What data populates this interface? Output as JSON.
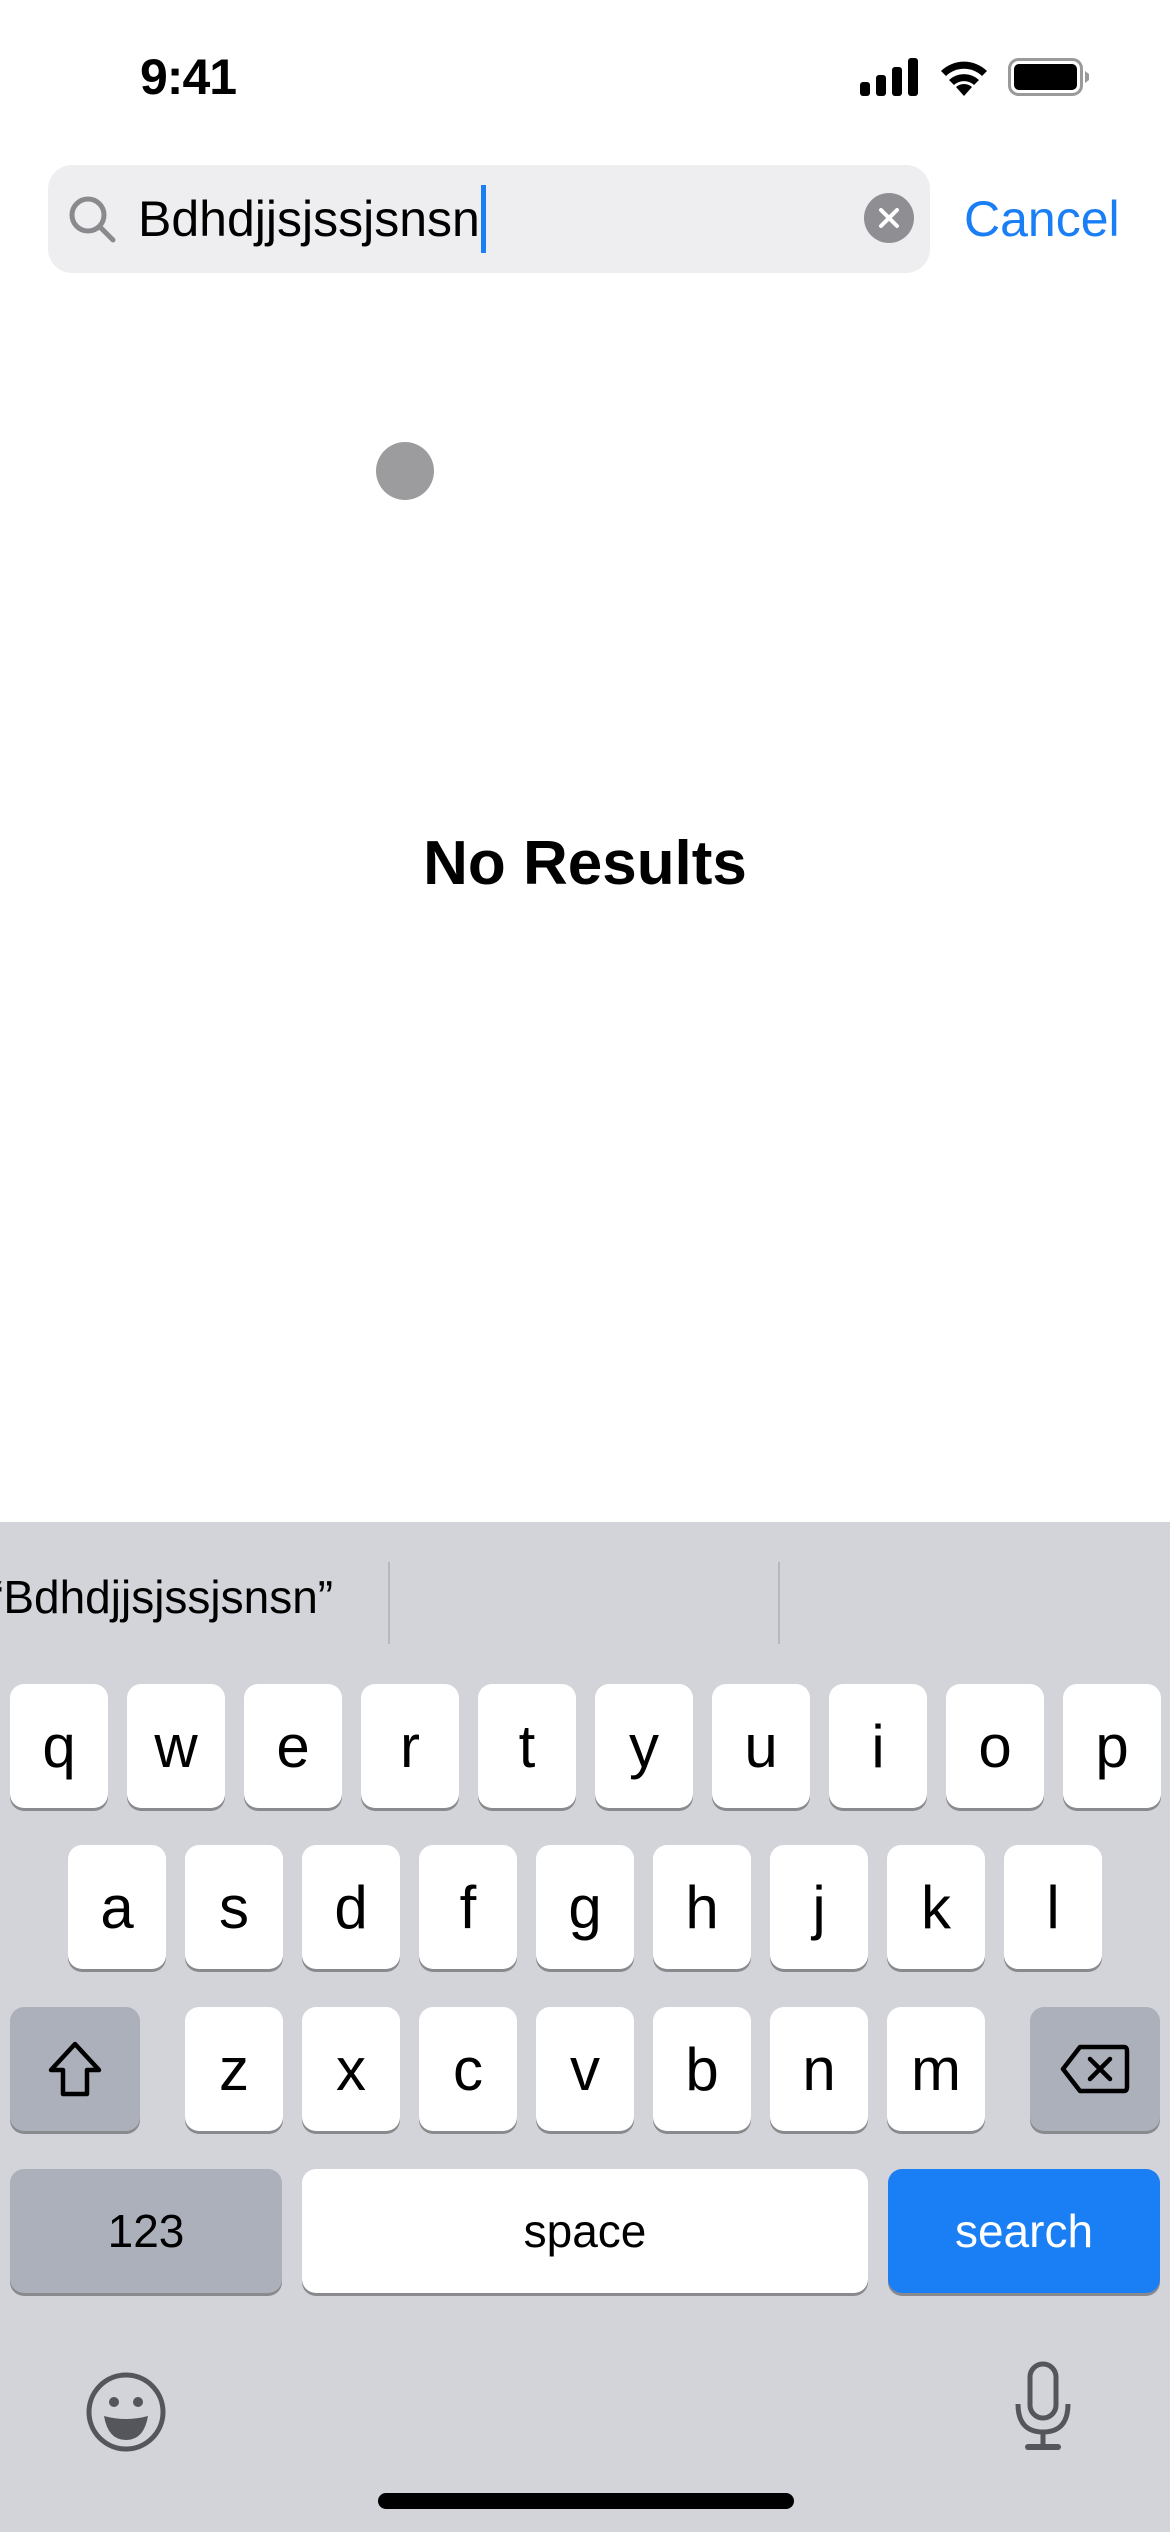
{
  "status_bar": {
    "time": "9:41",
    "icons": [
      "cellular-signal-icon",
      "wifi-icon",
      "battery-icon"
    ]
  },
  "search": {
    "value": "Bdhdjjsjssjsnsn",
    "cancel_label": "Cancel",
    "icons": {
      "search": "magnifying-glass-icon",
      "clear": "clear-x-icon"
    },
    "accent_color": "#1a7ef5"
  },
  "content": {
    "empty_state": "No Results"
  },
  "keyboard": {
    "predictive": [
      "“Bdhdjjsjssjsnsn”",
      "",
      ""
    ],
    "row1": [
      "q",
      "w",
      "e",
      "r",
      "t",
      "y",
      "u",
      "i",
      "o",
      "p"
    ],
    "row2": [
      "a",
      "s",
      "d",
      "f",
      "g",
      "h",
      "j",
      "k",
      "l"
    ],
    "row3": [
      "z",
      "x",
      "c",
      "v",
      "b",
      "n",
      "m"
    ],
    "numbers_label": "123",
    "space_label": "space",
    "return_label": "search",
    "icons": {
      "shift": "shift-arrow-icon",
      "delete": "backspace-icon",
      "emoji": "emoji-icon",
      "dictation": "microphone-icon"
    }
  }
}
